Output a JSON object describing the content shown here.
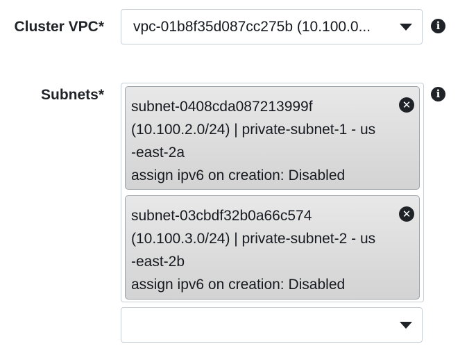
{
  "vpc": {
    "label": "Cluster VPC*",
    "selected_value": "vpc-01b8f35d087cc275b (10.100.0...",
    "info_icon": "info-icon"
  },
  "subnets": {
    "label": "Subnets*",
    "info_icon": "info-icon",
    "selected": [
      {
        "lines": [
          "subnet-0408cda087213999f",
          "(10.100.2.0/24) | private-subnet-1 - us",
          "-east-2a",
          "assign ipv6 on creation: Disabled"
        ],
        "remove_icon": "close-icon"
      },
      {
        "lines": [
          "subnet-03cbdf32b0a66c574",
          "(10.100.3.0/24) | private-subnet-2 - us",
          "-east-2b",
          "assign ipv6 on creation: Disabled"
        ],
        "remove_icon": "close-icon"
      }
    ],
    "add_select_value": ""
  },
  "colors": {
    "text": "#16191f",
    "border": "#c9ced4",
    "token_bg": "#d3d3d3",
    "icon": "#1f2328"
  }
}
